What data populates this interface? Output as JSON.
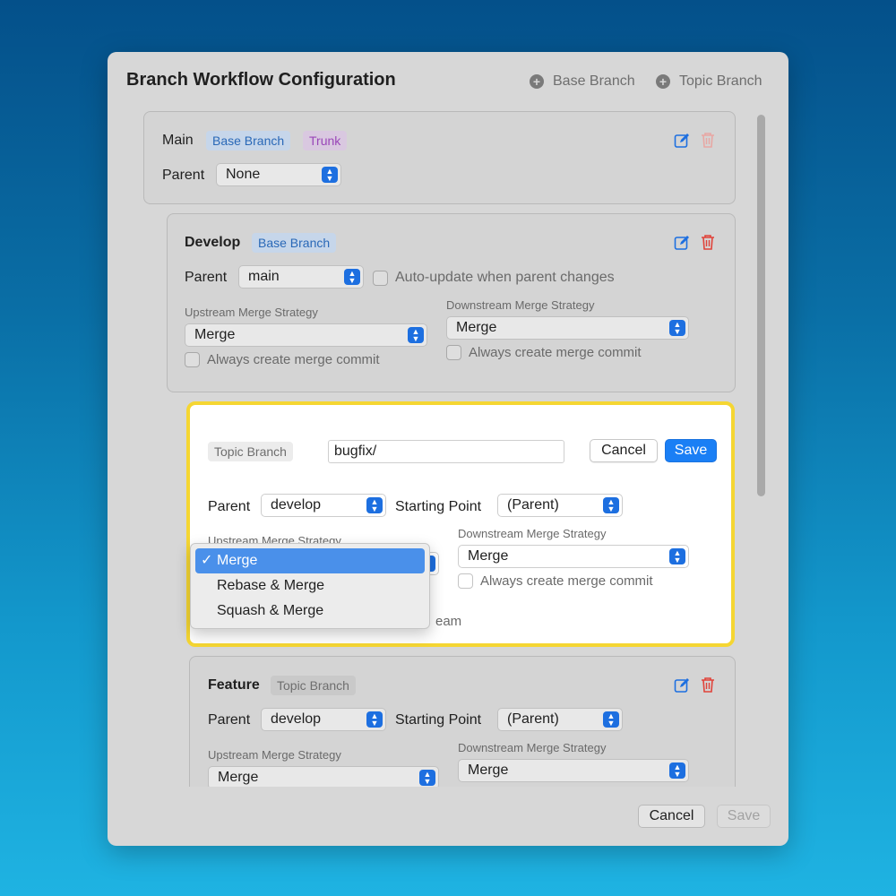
{
  "window": {
    "title": "Branch Workflow Configuration",
    "add_base_label": "Base Branch",
    "add_topic_label": "Topic Branch"
  },
  "main_card": {
    "name": "Main",
    "tags": [
      "Base Branch",
      "Trunk"
    ],
    "parent_label": "Parent",
    "parent_value": "None"
  },
  "develop_card": {
    "name": "Develop",
    "tag": "Base Branch",
    "parent_label": "Parent",
    "parent_value": "main",
    "auto_update_label": "Auto-update when parent changes",
    "upstream_label": "Upstream Merge Strategy",
    "upstream_value": "Merge",
    "upstream_commit_label": "Always create merge commit",
    "downstream_label": "Downstream Merge Strategy",
    "downstream_value": "Merge",
    "downstream_commit_label": "Always create merge commit"
  },
  "editor": {
    "tag": "Topic Branch",
    "prefix_value": "bugfix/",
    "cancel_label": "Cancel",
    "save_label": "Save",
    "parent_label": "Parent",
    "parent_value": "develop",
    "starting_point_label": "Starting Point",
    "starting_point_value": "(Parent)",
    "upstream_label": "Upstream Merge Strategy",
    "downstream_label": "Downstream Merge Strategy",
    "downstream_value": "Merge",
    "downstream_commit_label": "Always create merge commit",
    "obscured_text": "eam"
  },
  "dropdown": {
    "check": "✓",
    "options": [
      "Merge",
      "Rebase & Merge",
      "Squash & Merge"
    ],
    "selected": "Merge"
  },
  "feature_card": {
    "name": "Feature",
    "tag": "Topic Branch",
    "parent_label": "Parent",
    "parent_value": "develop",
    "starting_point_label": "Starting Point",
    "starting_point_value": "(Parent)",
    "upstream_label": "Upstream Merge Strategy",
    "upstream_value": "Merge",
    "downstream_label": "Downstream Merge Strategy",
    "downstream_value": "Merge"
  },
  "footer": {
    "cancel_label": "Cancel",
    "save_label": "Save"
  },
  "colors": {
    "accent": "#1a7ff5",
    "highlight_border": "#f5d632",
    "trash_red": "#e0433a",
    "edit_blue": "#1d6fe0"
  }
}
